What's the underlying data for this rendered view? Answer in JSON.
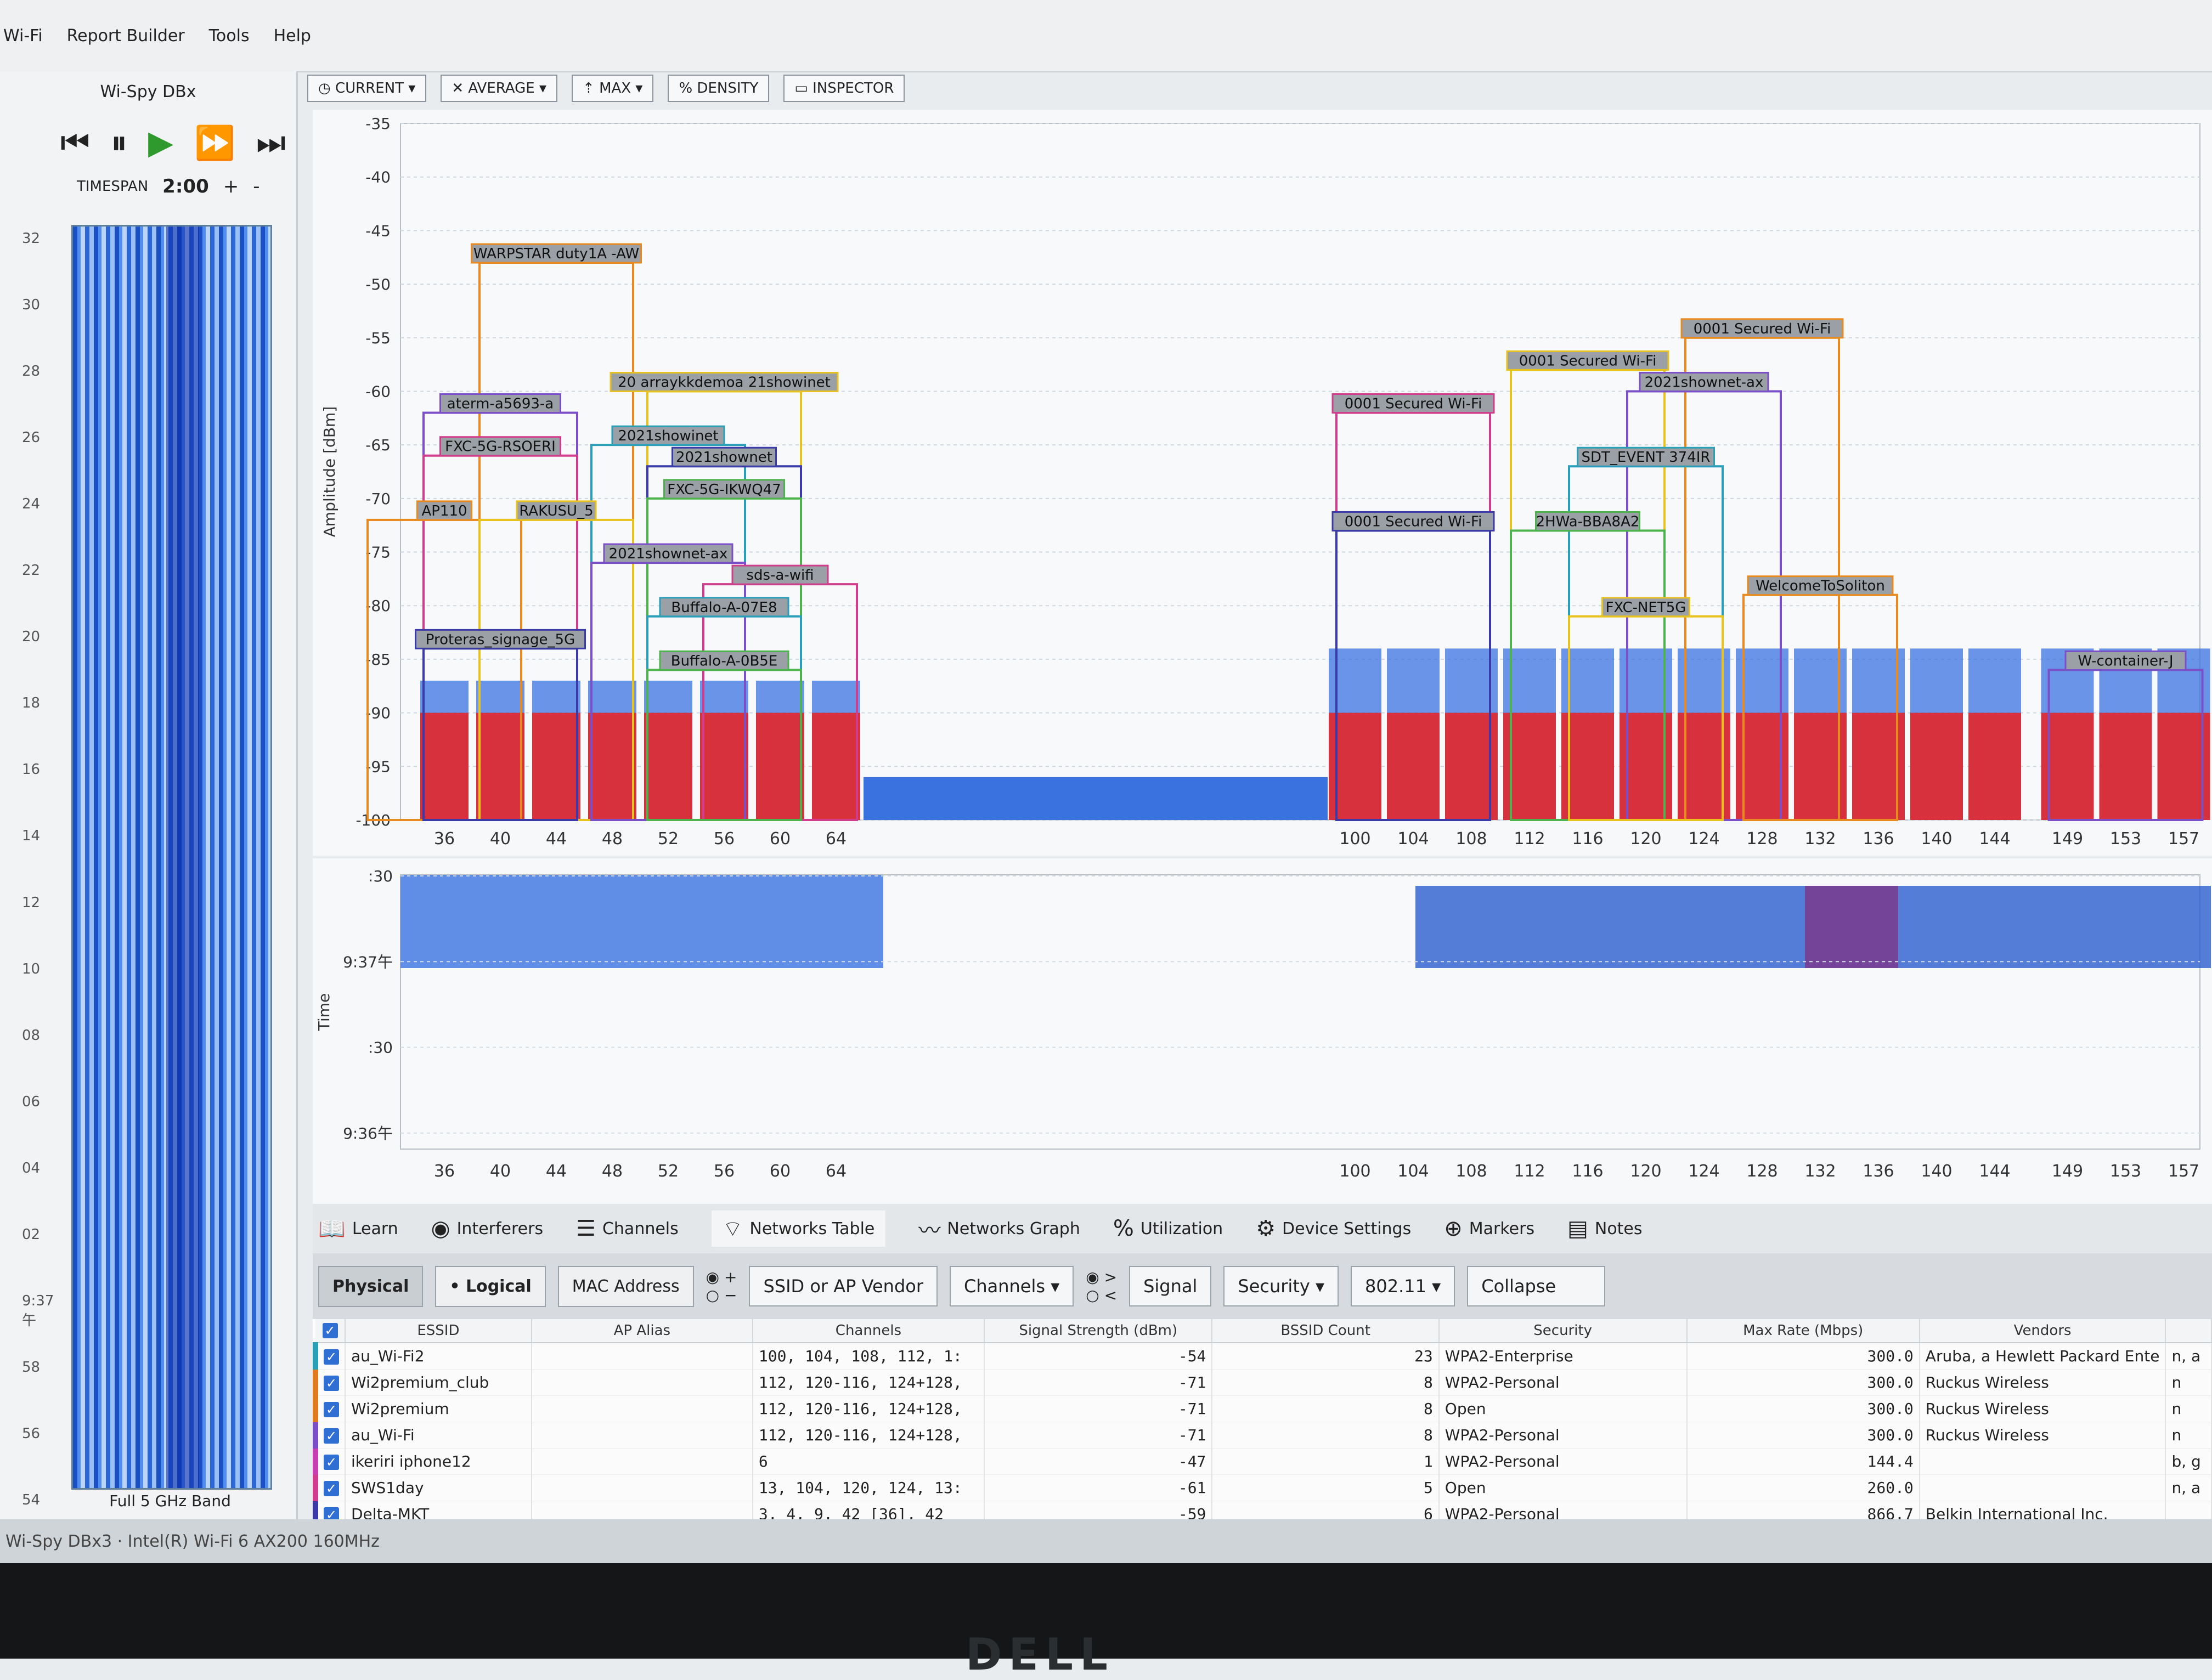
{
  "menu": [
    "Wi-Fi",
    "Report Builder",
    "Tools",
    "Help"
  ],
  "app_title": "Wi-Spy DBx",
  "timespan": {
    "label": "TIMESPAN",
    "value": "2:00",
    "plus": "+",
    "minus": "-"
  },
  "band_label": "Full 5 GHz Band",
  "side_ticks": [
    "32",
    "30",
    "28",
    "26",
    "24",
    "22",
    "20",
    "18",
    "16",
    "14",
    "12",
    "10",
    "08",
    "06",
    "04",
    "02",
    "9:37午",
    "58",
    "56",
    "54"
  ],
  "toolbar": [
    "CURRENT",
    "AVERAGE",
    "MAX",
    "DENSITY",
    "INSPECTOR"
  ],
  "amp_chart": {
    "ylabel": "Amplitude [dBm]",
    "yticks": [
      -35,
      -40,
      -45,
      -50,
      -55,
      -60,
      -65,
      -70,
      -75,
      -80,
      -85,
      -90,
      -95,
      -100
    ],
    "channels_left": [
      "36",
      "40",
      "44",
      "48",
      "52",
      "56",
      "60",
      "64"
    ],
    "channels_right": [
      "100",
      "104",
      "108",
      "112",
      "116",
      "120",
      "124",
      "128",
      "132",
      "136",
      "140",
      "144",
      "149",
      "153",
      "157"
    ],
    "networks": [
      {
        "label": "WARPSTAR duty1A -AW",
        "ch": 44,
        "top": -48
      },
      {
        "label": "20 arraykkdemoa 21showinet",
        "ch": 56,
        "top": -60
      },
      {
        "label": "aterm-a5693-a",
        "ch": 40,
        "top": -62
      },
      {
        "label": "FXC-5G-RSOERI",
        "ch": 40,
        "top": -66
      },
      {
        "label": "2021showinet",
        "ch": 52,
        "top": -65
      },
      {
        "label": "2021shownet",
        "ch": 56,
        "top": -67
      },
      {
        "label": "FXC-5G-IKWQ47",
        "ch": 56,
        "top": -70
      },
      {
        "label": "AP110",
        "ch": 36,
        "top": -72
      },
      {
        "label": "RAKUSU_5",
        "ch": 44,
        "top": -72
      },
      {
        "label": "2021shownet-ax",
        "ch": 52,
        "top": -76
      },
      {
        "label": "sds-a-wifi",
        "ch": 60,
        "top": -78
      },
      {
        "label": "Buffalo-A-07E8",
        "ch": 56,
        "top": -81
      },
      {
        "label": "Proteras_signage_5G",
        "ch": 40,
        "top": -84
      },
      {
        "label": "Buffalo-A-0B5E",
        "ch": 56,
        "top": -86
      },
      {
        "label": "0001 Secured Wi-Fi",
        "ch": 128,
        "top": -55
      },
      {
        "label": "0001 Secured Wi-Fi",
        "ch": 116,
        "top": -58
      },
      {
        "label": "2021shownet-ax",
        "ch": 124,
        "top": -60
      },
      {
        "label": "0001 Secured Wi-Fi",
        "ch": 104,
        "top": -62
      },
      {
        "label": "SDT_EVENT 374IR",
        "ch": 120,
        "top": -67
      },
      {
        "label": "0001 Secured Wi-Fi",
        "ch": 104,
        "top": -73
      },
      {
        "label": "2HWa-BBA8A2",
        "ch": 116,
        "top": -73
      },
      {
        "label": "WelcomeToSoliton",
        "ch": 132,
        "top": -79
      },
      {
        "label": "FXC-NET5G",
        "ch": 120,
        "top": -81
      },
      {
        "label": "W-container-J",
        "ch": 153,
        "top": -86
      }
    ]
  },
  "time_chart": {
    "ylabel": "Time",
    "yticks": [
      ":30",
      "9:37午",
      ":30",
      "9:36午"
    ]
  },
  "bottom_tabs": [
    "Learn",
    "Interferers",
    "Channels",
    "Networks Table",
    "Networks Graph",
    "Utilization",
    "Device Settings",
    "Markers",
    "Notes"
  ],
  "filters": {
    "physical": "Physical",
    "logical": "• Logical",
    "mac": "MAC Address",
    "plus": "+",
    "minus": "−",
    "ssid": "SSID or AP Vendor",
    "channels": "Channels",
    "gt": ">",
    "lt": "<",
    "signal": "Signal",
    "security": "Security",
    "proto": "802.11",
    "collapse": "Collapse"
  },
  "table": {
    "headers": [
      "ESSID",
      "AP Alias",
      "Channels",
      "Signal Strength (dBm)",
      "BSSID Count",
      "Security",
      "Max Rate (Mbps)",
      "Vendors"
    ],
    "rows": [
      {
        "essid": "au_Wi-Fi2",
        "alias": "",
        "channels": "100, 104, 108, 112, 1:",
        "signal": "-54",
        "count": "23",
        "security": "WPA2-Enterprise",
        "rate": "300.0",
        "vendors": "Aruba, a Hewlett Packard Ente",
        "extra": "n, a",
        "color": "#2aa0b8"
      },
      {
        "essid": "Wi2premium_club",
        "alias": "",
        "channels": "112, 120-116, 124+128,",
        "signal": "-71",
        "count": "8",
        "security": "WPA2-Personal",
        "rate": "300.0",
        "vendors": "Ruckus Wireless",
        "extra": "n",
        "color": "#e07b1f"
      },
      {
        "essid": "Wi2premium",
        "alias": "",
        "channels": "112, 120-116, 124+128,",
        "signal": "-71",
        "count": "8",
        "security": "Open",
        "rate": "300.0",
        "vendors": "Ruckus Wireless",
        "extra": "n",
        "color": "#e07b1f"
      },
      {
        "essid": "au_Wi-Fi",
        "alias": "",
        "channels": "112, 120-116, 124+128,",
        "signal": "-71",
        "count": "8",
        "security": "WPA2-Personal",
        "rate": "300.0",
        "vendors": "Ruckus Wireless",
        "extra": "n",
        "color": "#7b4fc8"
      },
      {
        "essid": "ikeriri iphone12",
        "alias": "",
        "channels": "6",
        "signal": "-47",
        "count": "1",
        "security": "WPA2-Personal",
        "rate": "144.4",
        "vendors": "",
        "extra": "b, g",
        "color": "#c83fb0"
      },
      {
        "essid": "SWS1day",
        "alias": "",
        "channels": "13, 104, 120, 124, 13:",
        "signal": "-61",
        "count": "5",
        "security": "Open",
        "rate": "260.0",
        "vendors": "",
        "extra": "n, a",
        "color": "#d23c8c"
      },
      {
        "essid": "Delta-MKT",
        "alias": "",
        "channels": "3, 4, 9, 42 [36], 42",
        "signal": "-59",
        "count": "6",
        "security": "WPA2-Personal",
        "rate": "866.7",
        "vendors": "Belkin International Inc.",
        "extra": "",
        "color": "#3a3aa8"
      }
    ]
  },
  "status": "Wi-Spy DBx3 · Intel(R) Wi-Fi 6 AX200 160MHz",
  "brand": "DELL"
}
